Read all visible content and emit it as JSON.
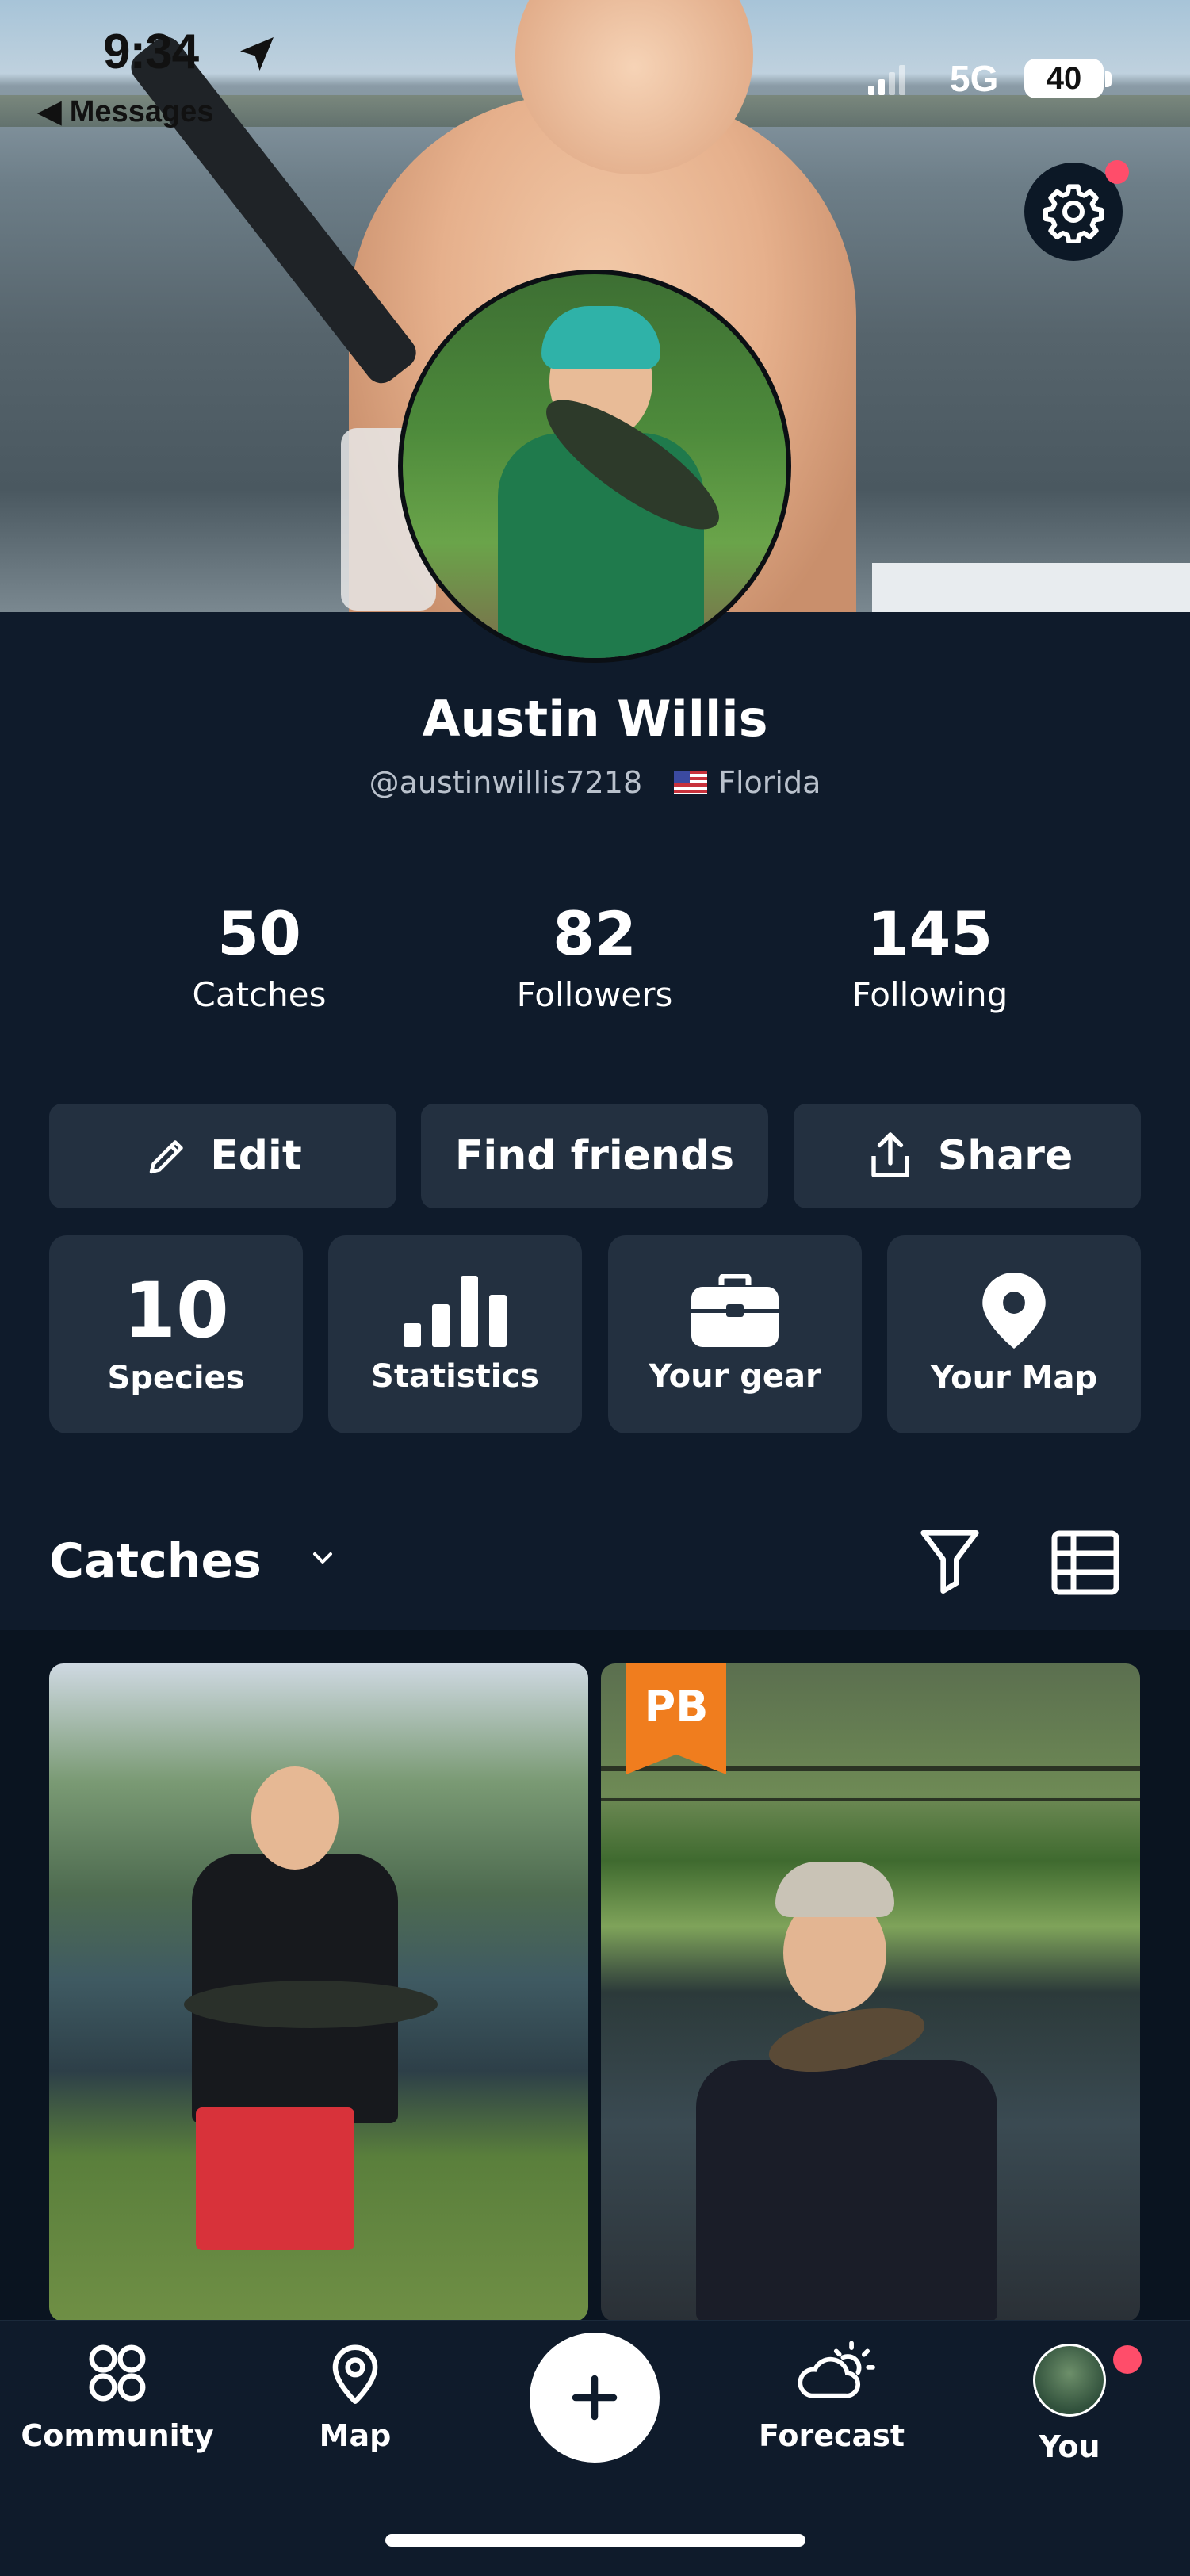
{
  "status_bar": {
    "time": "9:34",
    "back_label": "◀ Messages",
    "network": "5G",
    "battery": "40"
  },
  "profile": {
    "name": "Austin Willis",
    "handle": "@austinwillis7218",
    "location": "Florida",
    "stats": [
      {
        "value": "50",
        "label": "Catches"
      },
      {
        "value": "82",
        "label": "Followers"
      },
      {
        "value": "145",
        "label": "Following"
      }
    ]
  },
  "actions": {
    "edit": "Edit",
    "find_friends": "Find friends",
    "share": "Share"
  },
  "tiles": {
    "species_count": "10",
    "species": "Species",
    "statistics": "Statistics",
    "gear": "Your gear",
    "map": "Your Map"
  },
  "catches": {
    "title": "Catches",
    "pb_badge": "PB"
  },
  "tabs": {
    "community": "Community",
    "map": "Map",
    "forecast": "Forecast",
    "you": "You"
  },
  "colors": {
    "background": "#0f1b2b",
    "card": "#233040",
    "notification": "#ff4d6a",
    "pb_badge": "#f07d1e"
  }
}
